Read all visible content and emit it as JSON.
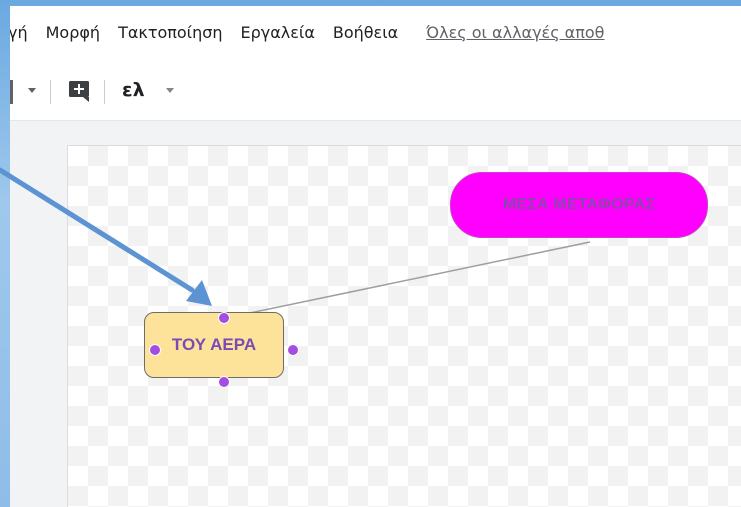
{
  "menu": {
    "items": [
      "γή",
      "Μορφή",
      "Τακτοποίηση",
      "Εργαλεία",
      "Βοήθεια"
    ],
    "saved_status": "Όλες οι αλλαγές αποθ"
  },
  "toolbar": {
    "input_tools_label": "ελ"
  },
  "diagram": {
    "pill_label": "ΜΕΣΑ ΜΕΤΑΦΟΡΑΣ",
    "node_label": "ΤΟΥ ΑΕΡΑ"
  },
  "colors": {
    "pill_fill": "#ff00ff",
    "pill_text": "#8e44ad",
    "node_fill": "#fde29a",
    "node_text": "#7b4bb5",
    "handle": "#a44de0",
    "arrow": "#5b93d3"
  },
  "icons": {
    "comment": "add-comment-icon",
    "caret": "caret-down-icon"
  }
}
